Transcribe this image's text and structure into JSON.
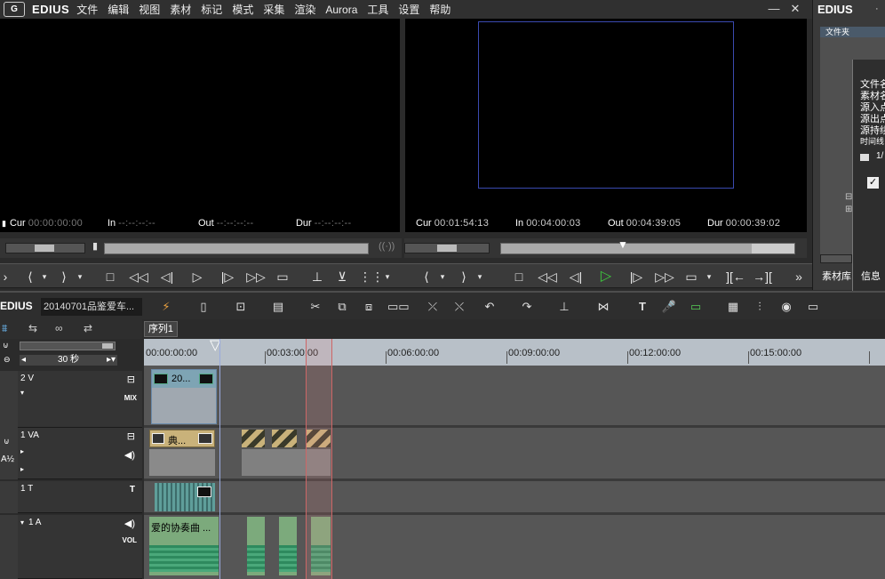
{
  "app": {
    "logo": "G",
    "brand": "EDIUS"
  },
  "menu": [
    "文件",
    "编辑",
    "视图",
    "素材",
    "标记",
    "模式",
    "采集",
    "渲染",
    "Aurora",
    "工具",
    "设置",
    "帮助"
  ],
  "window_controls": {
    "minimize": "—",
    "close": "✕"
  },
  "player": {
    "cur_label": "Cur",
    "cur": "00:00:00:00",
    "in_label": "In",
    "in": "--:--:--:--",
    "out_label": "Out",
    "out": "--:--:--:--",
    "dur_label": "Dur",
    "dur": "--:--:--:--"
  },
  "recorder": {
    "cur_label": "Cur",
    "cur": "00:01:54:13",
    "in_label": "In",
    "in": "00:04:00:03",
    "out_label": "Out",
    "out": "00:04:39:05",
    "dur_label": "Dur",
    "dur": "00:00:39:02"
  },
  "right_panel": {
    "title": "EDIUS",
    "folder_tab": "文件夹",
    "info_lines": [
      "文件名",
      "素材名",
      "源入点",
      "源出点",
      "源持续",
      "时间线"
    ],
    "counter": "1/",
    "bottom_tab_bin": "素材库",
    "bottom_tab_info": "信息"
  },
  "timeline": {
    "brand": "EDIUS",
    "project_name": "20140701品鉴爱车...",
    "sequence_tab": "序列1",
    "scale": "30 秒",
    "ruler": [
      "00:00:00:00",
      "00:03:00:00",
      "00:06:00:00",
      "00:09:00:00",
      "00:12:00:00",
      "00:15:00:00"
    ],
    "tracks": [
      {
        "name": "2 V",
        "tag": "MIX"
      },
      {
        "name": "1 VA",
        "tag": ""
      },
      {
        "name": "1 T",
        "tag": "T"
      },
      {
        "name": "1 A",
        "tag": "VOL"
      }
    ],
    "clips": {
      "v2": "20...",
      "va": "典...",
      "audio": "爱的协奏曲 ..."
    }
  },
  "colors": {
    "play_green": "#3ec83e",
    "clip_video": "#a0a8b0",
    "clip_va": "#c9b27a",
    "clip_title": "#5f9e9a",
    "clip_audio": "#3a9a70",
    "ruler": "#b8c0c8"
  }
}
